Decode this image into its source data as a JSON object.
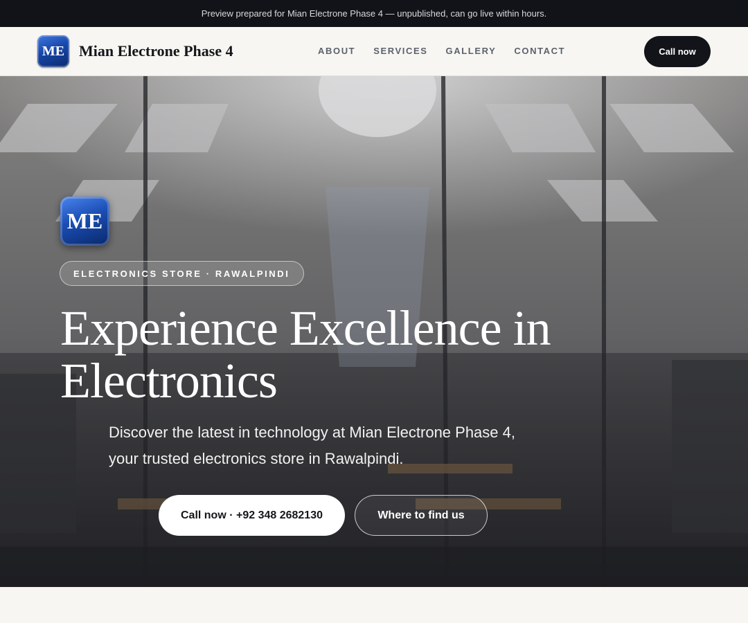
{
  "banner": {
    "text": "Preview prepared for Mian Electrone Phase 4 — unpublished, can go live within hours."
  },
  "header": {
    "logo_text": "ME",
    "brand_name": "Mian Electrone Phase 4",
    "nav": [
      "ABOUT",
      "SERVICES",
      "GALLERY",
      "CONTACT"
    ],
    "cta_label": "Call now"
  },
  "hero": {
    "logo_text": "ME",
    "badge": "ELECTRONICS STORE · RAWALPINDI",
    "title": "Experience Excellence in Electronics",
    "subtitle": "Discover the latest in technology at Mian Electrone Phase 4, your trusted electronics store in Rawalpindi.",
    "primary_button": "Call now · +92 348 2682130",
    "secondary_button": "Where to find us",
    "background": "store-interior-photo"
  },
  "colors": {
    "banner_bg": "#111318",
    "page_bg": "#f7f6f2",
    "dark_button": "#121419",
    "logo_blue": "#1747a8"
  }
}
